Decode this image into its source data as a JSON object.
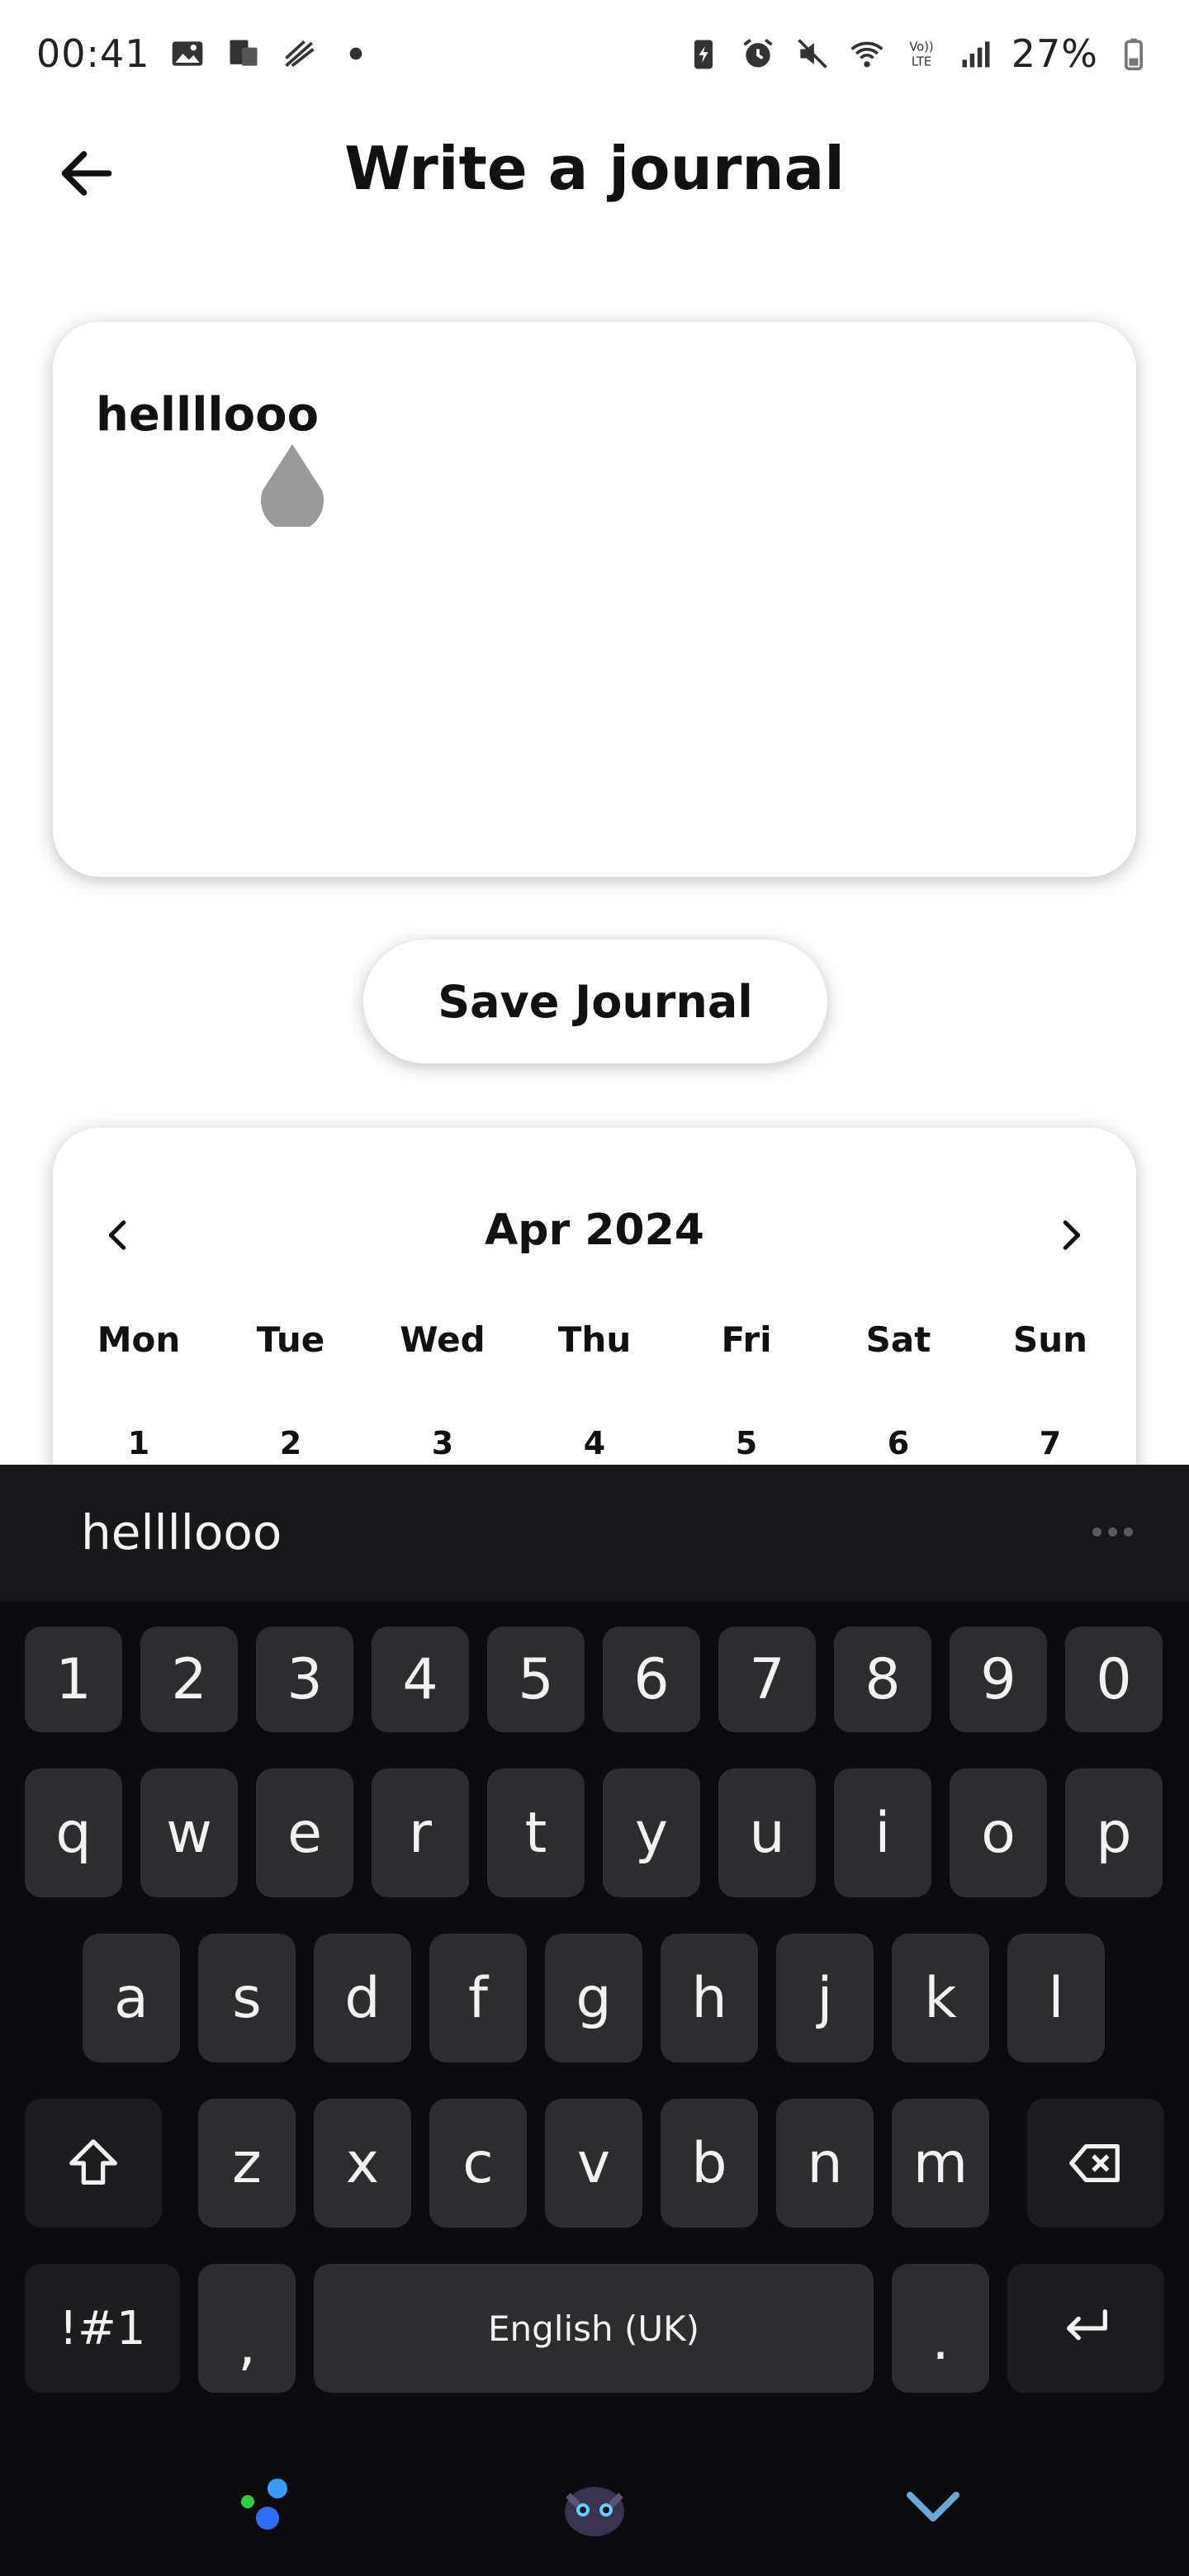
{
  "status_bar": {
    "time": "00:41",
    "battery": "27%",
    "left_icons": [
      "image-icon",
      "cast-icon",
      "pen-icon",
      "dot-icon"
    ],
    "right_icons": [
      "battery-saver-icon",
      "alarm-icon",
      "mute-icon",
      "wifi-icon",
      "volte-icon",
      "signal-icon",
      "battery-icon"
    ]
  },
  "header": {
    "title": "Write a journal",
    "back_icon": "arrow-left-icon"
  },
  "journal": {
    "text": "hellllooo"
  },
  "save_button": {
    "label": "Save Journal"
  },
  "calendar": {
    "month_label": "Apr 2024",
    "weekdays": [
      "Mon",
      "Tue",
      "Wed",
      "Thu",
      "Fri",
      "Sat",
      "Sun"
    ],
    "visible_days": [
      "1",
      "2",
      "3",
      "4",
      "5",
      "6",
      "7"
    ]
  },
  "keyboard": {
    "suggestion": "hellllooo",
    "number_row": [
      "1",
      "2",
      "3",
      "4",
      "5",
      "6",
      "7",
      "8",
      "9",
      "0"
    ],
    "row1": [
      "q",
      "w",
      "e",
      "r",
      "t",
      "y",
      "u",
      "i",
      "o",
      "p"
    ],
    "row2": [
      "a",
      "s",
      "d",
      "f",
      "g",
      "h",
      "j",
      "k",
      "l"
    ],
    "row3": [
      "z",
      "x",
      "c",
      "v",
      "b",
      "n",
      "m"
    ],
    "symbols_label": "!#1",
    "comma_label": ",",
    "space_label": "English (UK)",
    "period_label": ".",
    "shift_icon": "shift-icon",
    "backspace_icon": "backspace-icon",
    "enter_icon": "enter-icon",
    "colors": {
      "background": "#0c0c0e",
      "key": "#2d2d30",
      "key_dark": "#1d1d20",
      "text": "#f2f2f2"
    }
  },
  "bottom_nav": {
    "icons": [
      "sparkle-icon",
      "dragon-avatar-icon",
      "chevron-down-icon"
    ]
  }
}
